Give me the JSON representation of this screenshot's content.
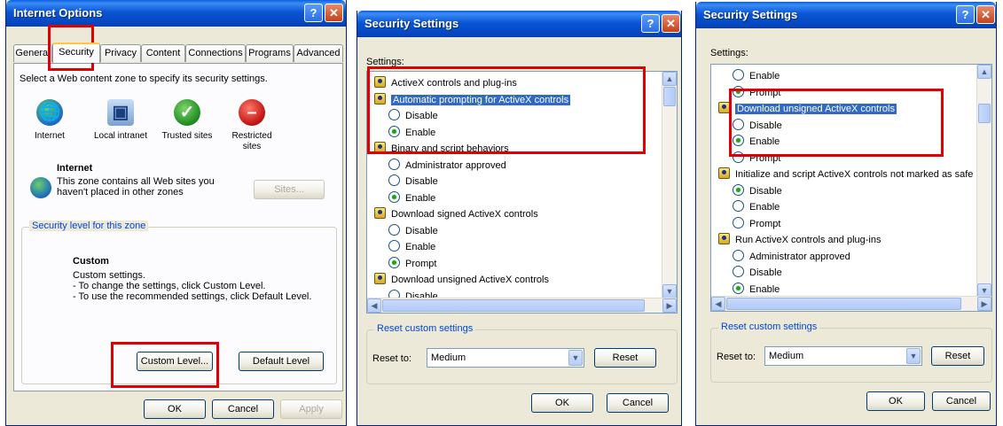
{
  "win1": {
    "title": "Internet Options",
    "tabs": [
      "General",
      "Security",
      "Privacy",
      "Content",
      "Connections",
      "Programs",
      "Advanced"
    ],
    "instruction": "Select a Web content zone to specify its security settings.",
    "zones": [
      {
        "label": "Internet",
        "icon": "globe-icon"
      },
      {
        "label": "Local intranet",
        "icon": "computer-icon"
      },
      {
        "label": "Trusted sites",
        "icon": "checkmark-icon"
      },
      {
        "label": "Restricted sites",
        "icon": "restricted-icon"
      }
    ],
    "zone_title": "Internet",
    "zone_desc": "This zone contains all Web sites you haven't placed in other zones",
    "sites_button": "Sites...",
    "group_label": "Security level for this zone",
    "level_title": "Custom",
    "level_desc_1": "Custom settings.",
    "level_desc_2": "- To change the settings, click Custom Level.",
    "level_desc_3": "- To use the recommended settings, click Default Level.",
    "custom_level_button": "Custom Level...",
    "default_level_button": "Default Level",
    "ok_button": "OK",
    "cancel_button": "Cancel",
    "apply_button": "Apply"
  },
  "win2": {
    "title": "Security Settings",
    "settings_label": "Settings:",
    "rows": [
      {
        "kind": "category",
        "text": "ActiveX controls and plug-ins"
      },
      {
        "kind": "category",
        "text": "Automatic prompting for ActiveX controls",
        "selected": true
      },
      {
        "kind": "radio",
        "text": "Disable",
        "checked": false
      },
      {
        "kind": "radio",
        "text": "Enable",
        "checked": true
      },
      {
        "kind": "category",
        "text": "Binary and script behaviors"
      },
      {
        "kind": "radio",
        "text": "Administrator approved",
        "checked": false
      },
      {
        "kind": "radio",
        "text": "Disable",
        "checked": false
      },
      {
        "kind": "radio",
        "text": "Enable",
        "checked": true
      },
      {
        "kind": "category",
        "text": "Download signed ActiveX controls"
      },
      {
        "kind": "radio",
        "text": "Disable",
        "checked": false
      },
      {
        "kind": "radio",
        "text": "Enable",
        "checked": false
      },
      {
        "kind": "radio",
        "text": "Prompt",
        "checked": true
      },
      {
        "kind": "category",
        "text": "Download unsigned ActiveX controls"
      },
      {
        "kind": "radio",
        "text": "Disable",
        "checked": false
      }
    ],
    "reset_group_label": "Reset custom settings",
    "reset_to_label": "Reset to:",
    "reset_value": "Medium",
    "reset_button": "Reset",
    "ok_button": "OK",
    "cancel_button": "Cancel"
  },
  "win3": {
    "title": "Security Settings",
    "settings_label": "Settings:",
    "rows": [
      {
        "kind": "radio",
        "text": "Enable",
        "checked": false
      },
      {
        "kind": "radio",
        "text": "Prompt",
        "checked": true
      },
      {
        "kind": "category",
        "text": "Download unsigned ActiveX controls",
        "selected": true
      },
      {
        "kind": "radio",
        "text": "Disable",
        "checked": false
      },
      {
        "kind": "radio",
        "text": "Enable",
        "checked": true
      },
      {
        "kind": "radio",
        "text": "Prompt",
        "checked": false
      },
      {
        "kind": "category",
        "text": "Initialize and script ActiveX controls not marked as safe"
      },
      {
        "kind": "radio",
        "text": "Disable",
        "checked": true
      },
      {
        "kind": "radio",
        "text": "Enable",
        "checked": false
      },
      {
        "kind": "radio",
        "text": "Prompt",
        "checked": false
      },
      {
        "kind": "category",
        "text": "Run ActiveX controls and plug-ins"
      },
      {
        "kind": "radio",
        "text": "Administrator approved",
        "checked": false
      },
      {
        "kind": "radio",
        "text": "Disable",
        "checked": false
      },
      {
        "kind": "radio",
        "text": "Enable",
        "checked": true
      }
    ],
    "reset_group_label": "Reset custom settings",
    "reset_to_label": "Reset to:",
    "reset_value": "Medium",
    "reset_button": "Reset",
    "ok_button": "OK",
    "cancel_button": "Cancel"
  },
  "colors": {
    "highlight_box": "#e00000",
    "selection": "#316ac5",
    "title_bar": "#0b55d5"
  }
}
